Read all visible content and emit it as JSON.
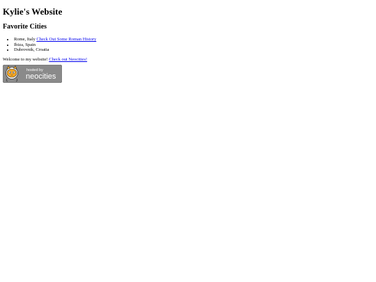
{
  "header": {
    "title": "Kylie's Website"
  },
  "favorites": {
    "heading": "Favorite Cities",
    "items": [
      {
        "text": "Rome, Italy ",
        "link": "Check Out Some Roman History"
      },
      {
        "text": "Ibiza, Spain"
      },
      {
        "text": "Dubrovnik, Croatia"
      }
    ]
  },
  "welcome": {
    "text": "Welcome to my website! ",
    "link": "Check out Neocities!"
  },
  "badge": {
    "top_text": "hosted by",
    "brand": "neocities",
    "bg_color": "#8a8a8a",
    "accent_color": "#f5a623"
  }
}
